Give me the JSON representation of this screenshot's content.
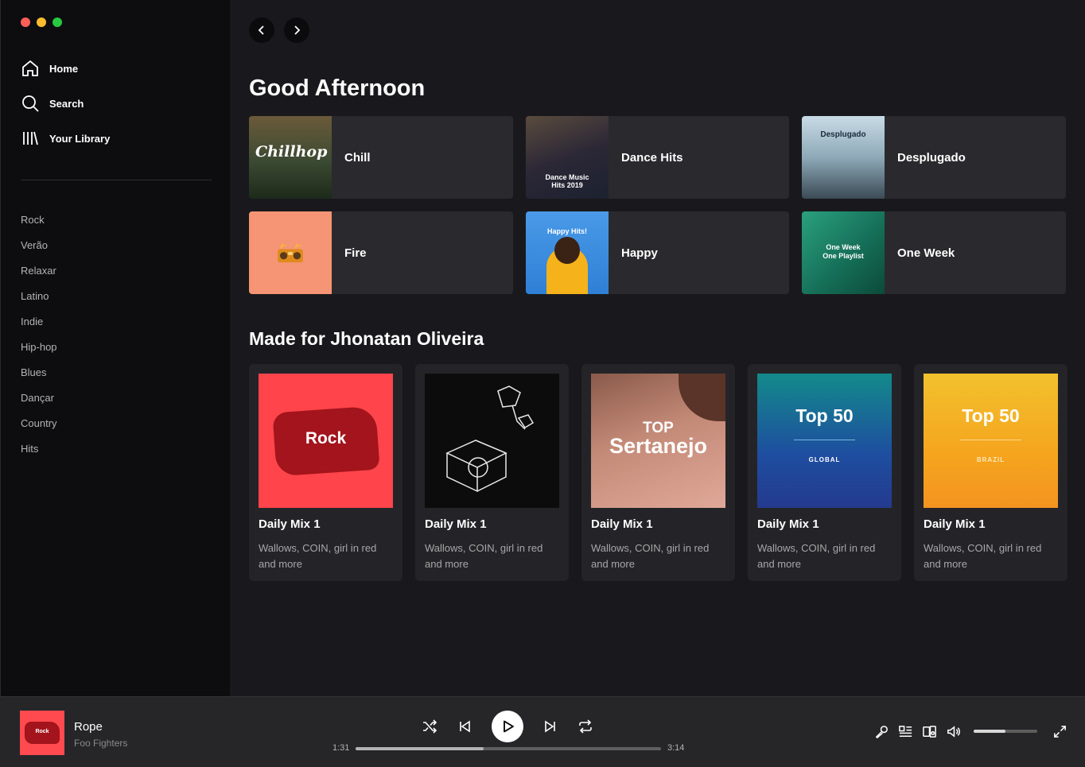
{
  "window": {
    "controls": [
      "#ff5f57",
      "#febc2e",
      "#28c840"
    ]
  },
  "nav": [
    {
      "label": "Home",
      "icon": "home-icon"
    },
    {
      "label": "Search",
      "icon": "search-icon"
    },
    {
      "label": "Your Library",
      "icon": "library-icon"
    }
  ],
  "playlists": [
    "Rock",
    "Verão",
    "Relaxar",
    "Latino",
    "Indie",
    "Hip-hop",
    "Blues",
    "Dançar",
    "Country",
    "Hits"
  ],
  "greeting": "Good Afternoon",
  "quick": [
    {
      "title": "Chill",
      "cover_text": "Chillhop",
      "color": "#3c4a35"
    },
    {
      "title": "Dance Hits",
      "cover_text": "Dance Music Hits 2019",
      "color": "#2b2e3d"
    },
    {
      "title": "Desplugado",
      "cover_text": "Desplugado",
      "color": "#9fb6c6"
    },
    {
      "title": "Fire",
      "cover_text": "",
      "color": "#f59575"
    },
    {
      "title": "Happy",
      "cover_text": "Happy Hits!",
      "color": "#3e8de3"
    },
    {
      "title": "One Week",
      "cover_text": "One Week One Playlist",
      "color": "#1d8a6c"
    }
  ],
  "made_for": "Made for Jhonatan Oliveira",
  "mixes": [
    {
      "title": "Daily Mix 1",
      "subtitle": "Wallows, COIN, girl in red and more",
      "cover_text": "Rock"
    },
    {
      "title": "Daily Mix 1",
      "subtitle": "Wallows, COIN, girl in red and more",
      "cover_text": ""
    },
    {
      "title": "Daily Mix 1",
      "subtitle": "Wallows, COIN, girl in red and more",
      "cover_text_top": "TOP",
      "cover_text": "Sertanejo"
    },
    {
      "title": "Daily Mix 1",
      "subtitle": "Wallows, COIN, girl in red and more",
      "cover_text": "Top 50",
      "cover_sub": "GLOBAL"
    },
    {
      "title": "Daily Mix 1",
      "subtitle": "Wallows, COIN, girl in red and more",
      "cover_text": "Top 50",
      "cover_sub": "BRAZIL"
    }
  ],
  "player": {
    "title": "Rope",
    "artist": "Foo Fighters",
    "art_text": "Rock",
    "elapsed": "1:31",
    "duration": "3:14",
    "progress": 0.42,
    "volume": 0.5
  }
}
